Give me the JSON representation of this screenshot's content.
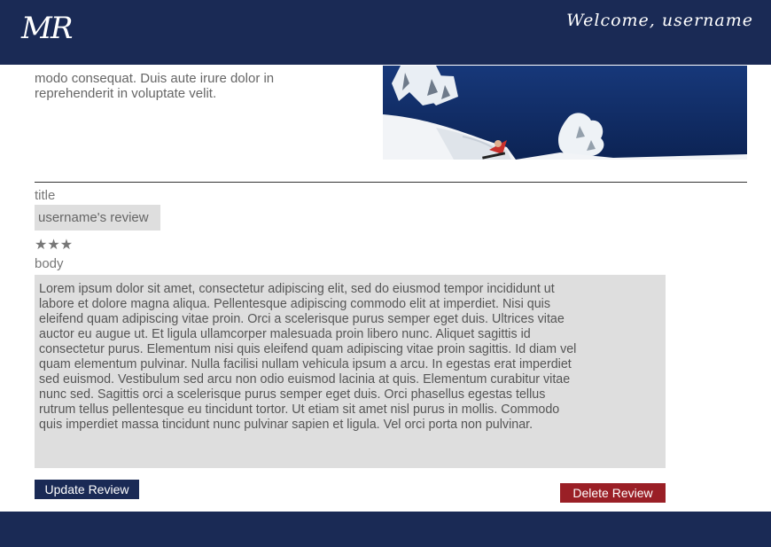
{
  "header": {
    "logo": "MR",
    "welcome": "Welcome, username"
  },
  "intro": {
    "text": "modo consequat. Duis aute irure dolor in reprehenderit in voluptate velit."
  },
  "review_form": {
    "title_label": "title",
    "title_value": "username's review",
    "rating": 3,
    "rating_display": "★★★",
    "body_label": "body",
    "body_value": "Lorem ipsum dolor sit amet, consectetur adipiscing elit, sed do eiusmod tempor incididunt ut labore et dolore magna aliqua. Pellentesque adipiscing commodo elit at imperdiet. Nisi quis eleifend quam adipiscing vitae proin. Orci a scelerisque purus semper eget duis. Ultrices vitae auctor eu augue ut. Et ligula ullamcorper malesuada proin libero nunc. Aliquet sagittis id consectetur purus. Elementum nisi quis eleifend quam adipiscing vitae proin sagittis. Id diam vel quam elementum pulvinar. Nulla facilisi nullam vehicula ipsum a arcu. In egestas erat imperdiet sed euismod. Vestibulum sed arcu non odio euismod lacinia at quis. Elementum curabitur vitae nunc sed. Sagittis orci a scelerisque purus semper eget duis. Orci phasellus egestas tellus rutrum tellus pellentesque eu tincidunt tortor. Ut etiam sit amet nisl purus in mollis. Commodo quis imperdiet massa tincidunt nunc pulvinar sapien et ligula. Vel orci porta non pulvinar.",
    "update_label": "Update Review",
    "delete_label": "Delete Review"
  },
  "colors": {
    "navy": "#1a2a55",
    "delete_red": "#9a1f26",
    "field_gray": "#dedede"
  }
}
